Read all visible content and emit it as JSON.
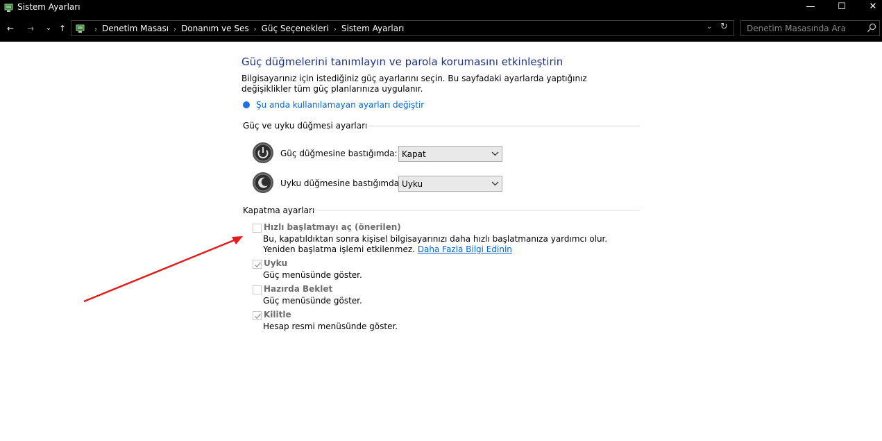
{
  "window": {
    "title": "Sistem Ayarları",
    "minimize_glyph": "—",
    "maximize_glyph": "☐",
    "close_glyph": "✕"
  },
  "nav": {
    "back_glyph": "←",
    "forward_glyph": "→",
    "recent_glyph": "⌄",
    "up_glyph": "↑"
  },
  "breadcrumb": [
    "Denetim Masası",
    "Donanım ve Ses",
    "Güç Seçenekleri",
    "Sistem Ayarları"
  ],
  "breadcrumb_sep": "›",
  "address": {
    "dropdown_glyph": "⌄",
    "refresh_glyph": "↻"
  },
  "search": {
    "placeholder": "Denetim Masasında Ara"
  },
  "main": {
    "title": "Güç düğmelerini tanımlayın ve parola korumasını etkinleştirin",
    "description": "Bilgisayarınız için istediğiniz güç ayarlarını seçin. Bu sayfadaki ayarlarda yaptığınız değişiklikler tüm güç planlarınıza uygulanır.",
    "change_link": "Şu anda kullanılamayan ayarları değiştir"
  },
  "power_buttons": {
    "heading": "Güç ve uyku düğmesi ayarları",
    "rows": [
      {
        "label": "Güç düğmesine bastığımda:",
        "value": "Kapat"
      },
      {
        "label": "Uyku düğmesine bastığımda:",
        "value": "Uyku"
      }
    ]
  },
  "shutdown": {
    "heading": "Kapatma ayarları",
    "items": [
      {
        "title": "Hızlı başlatmayı aç (önerilen)",
        "checked": false,
        "desc": "Bu, kapatıldıktan sonra kişisel bilgisayarınızı daha hızlı başlatmanıza yardımcı olur. Yeniden başlatma işlemi etkilenmez.",
        "link": "Daha Fazla Bilgi Edinin"
      },
      {
        "title": "Uyku",
        "checked": true,
        "desc": "Güç menüsünde göster."
      },
      {
        "title": "Hazırda Beklet",
        "checked": false,
        "desc": "Güç menüsünde göster."
      },
      {
        "title": "Kilitle",
        "checked": true,
        "desc": "Hesap resmi menüsünde göster."
      }
    ]
  },
  "colors": {
    "title_blue": "#1e3287",
    "link_blue": "#0066cc",
    "arrow_red": "#e31b1b"
  }
}
